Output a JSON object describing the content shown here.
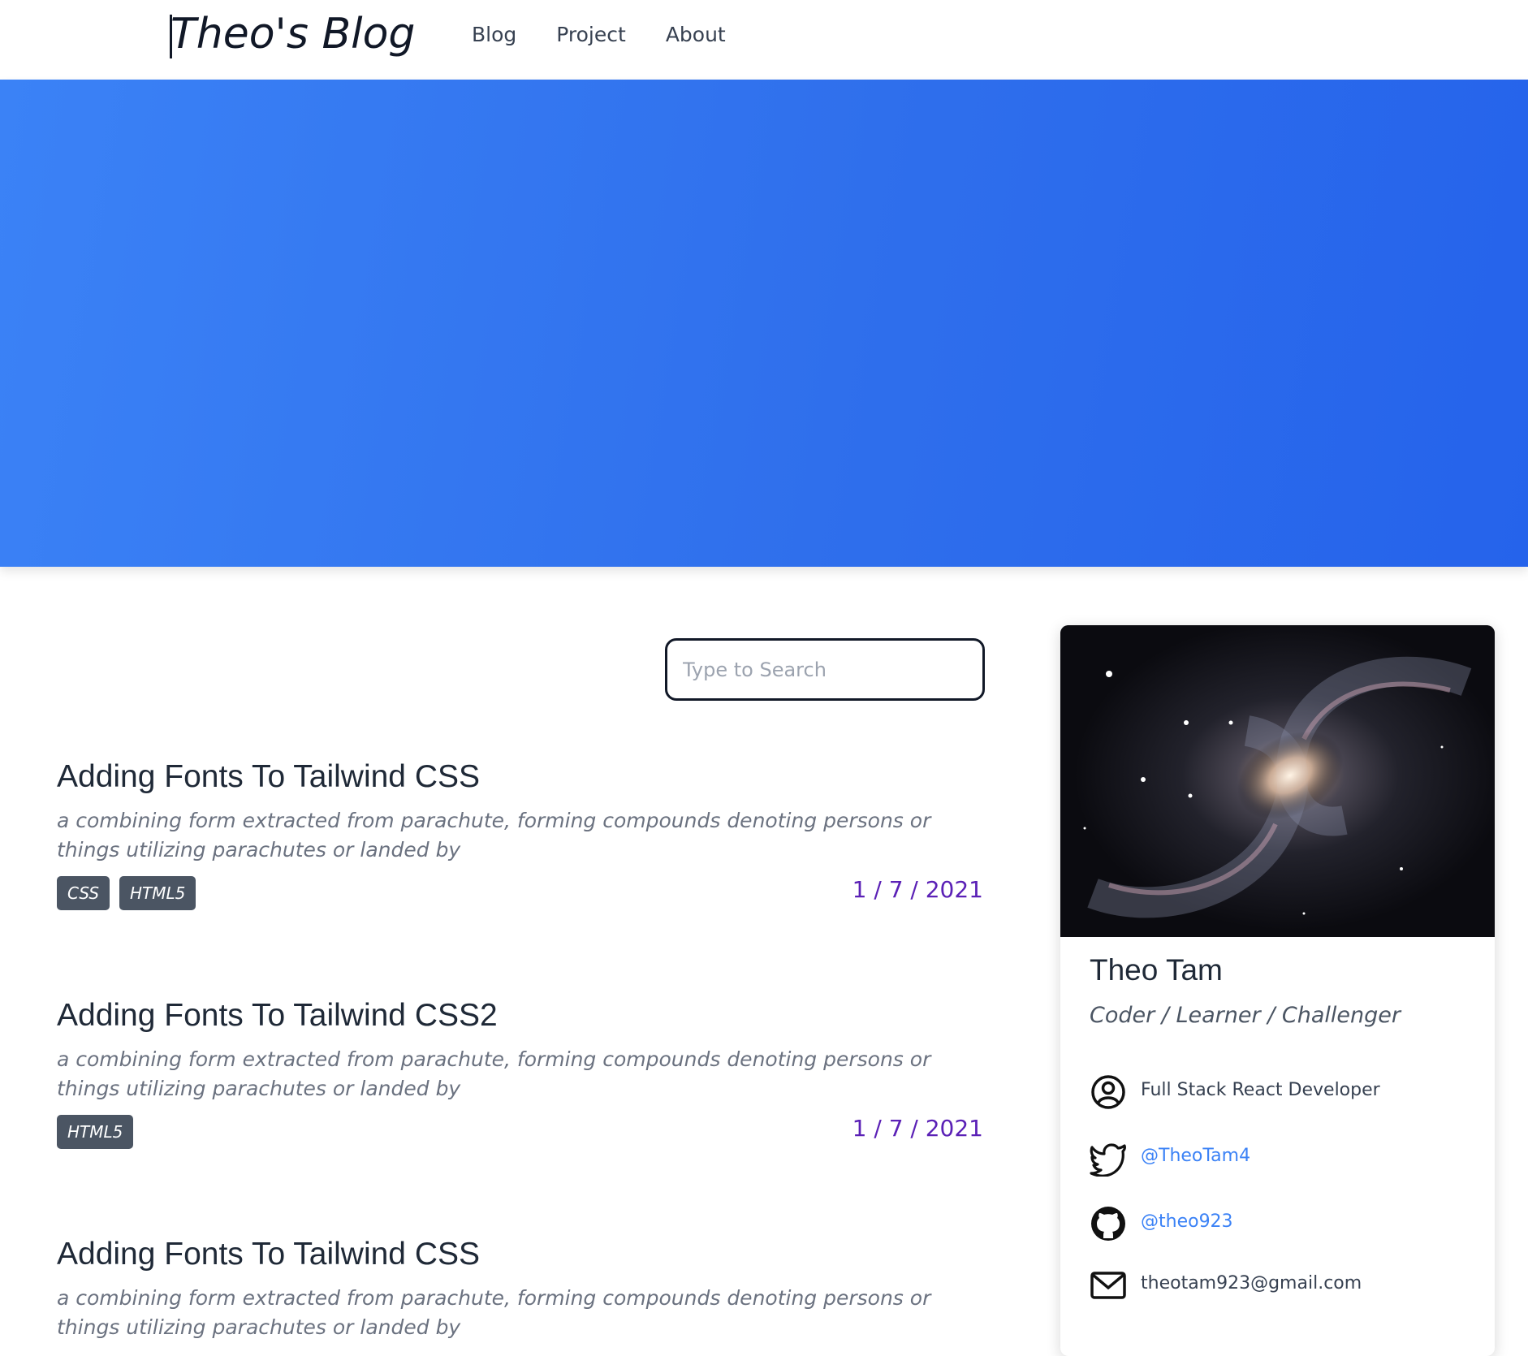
{
  "navbar": {
    "brand": "Theo's Blog",
    "links": [
      "Blog",
      "Project",
      "About"
    ]
  },
  "search": {
    "placeholder": "Type to Search",
    "value": ""
  },
  "posts": [
    {
      "title": "Adding Fonts To Tailwind CSS",
      "excerpt": "a combining form extracted from parachute, forming compounds denoting persons or things utilizing parachutes or landed by",
      "tags": [
        "CSS",
        "HTML5"
      ],
      "date": "1 / 7 / 2021"
    },
    {
      "title": "Adding Fonts To Tailwind CSS2",
      "excerpt": "a combining form extracted from parachute, forming compounds denoting persons or things utilizing parachutes or landed by",
      "tags": [
        "HTML5"
      ],
      "date": "1 / 7 / 2021"
    },
    {
      "title": "Adding Fonts To Tailwind CSS",
      "excerpt": "a combining form extracted from parachute, forming compounds denoting persons or things utilizing parachutes or landed by",
      "tags": [],
      "date": ""
    }
  ],
  "profile": {
    "name": "Theo Tam",
    "tagline": "Coder / Learner / Challenger",
    "role": "Full Stack React Developer",
    "twitter": "@TheoTam4",
    "github": "@theo923",
    "email": "theotam923@gmail.com"
  },
  "icons": {
    "user": "user-circle-icon",
    "twitter": "twitter-icon",
    "github": "github-icon",
    "email": "mail-icon"
  },
  "colors": {
    "hero_gradient_start": "#3b82f6",
    "hero_gradient_end": "#2563eb",
    "date": "#5b21b6",
    "tag_bg": "#4b5563",
    "link": "#3b82f6"
  }
}
